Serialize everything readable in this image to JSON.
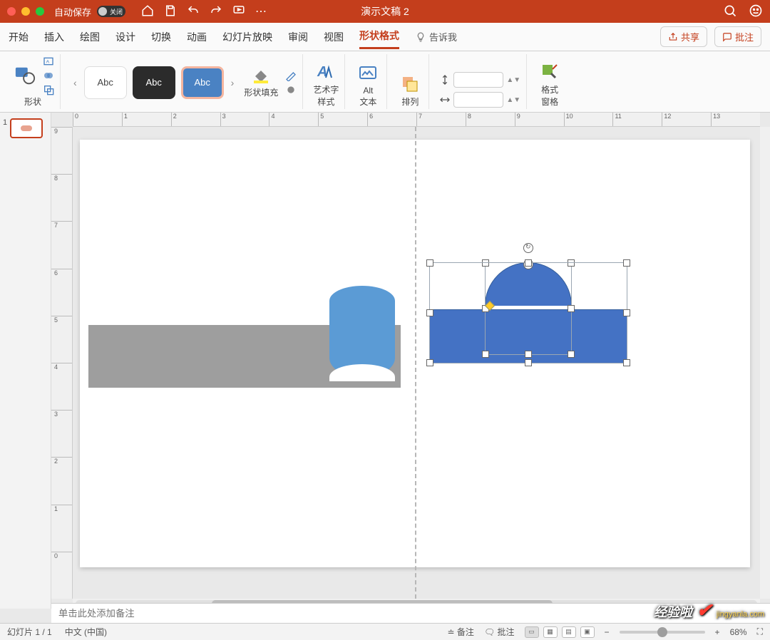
{
  "title": "演示文稿 2",
  "autosave": {
    "label": "自动保存",
    "state": "关闭"
  },
  "tabs": {
    "items": [
      "开始",
      "插入",
      "绘图",
      "设计",
      "切换",
      "动画",
      "幻灯片放映",
      "审阅",
      "视图",
      "形状格式"
    ],
    "active": 9,
    "tell_me": "告诉我"
  },
  "actions": {
    "share": "共享",
    "comment": "批注"
  },
  "ribbon": {
    "shapes_label": "形状",
    "gallery_text": "Abc",
    "fill_label": "形状填充",
    "wordart_label": "艺术字\n样式",
    "alttext_label": "Alt\n文本",
    "arrange_label": "排列",
    "format_pane_label": "格式\n窗格"
  },
  "ruler_h": [
    "0",
    "1",
    "2",
    "3",
    "4",
    "5",
    "6",
    "7",
    "8",
    "9",
    "10",
    "11",
    "12",
    "13"
  ],
  "ruler_v": [
    "0",
    "1",
    "2",
    "3",
    "4",
    "5",
    "6",
    "7",
    "8",
    "9"
  ],
  "thumb_number": "1",
  "notes_placeholder": "单击此处添加备注",
  "status": {
    "slide": "幻灯片 1 / 1",
    "lang": "中文 (中国)",
    "notes_btn": "备注",
    "comments_btn": "批注",
    "zoom": "68%"
  },
  "watermark": {
    "main": "经验啦",
    "sub": "jingyanla.com"
  }
}
